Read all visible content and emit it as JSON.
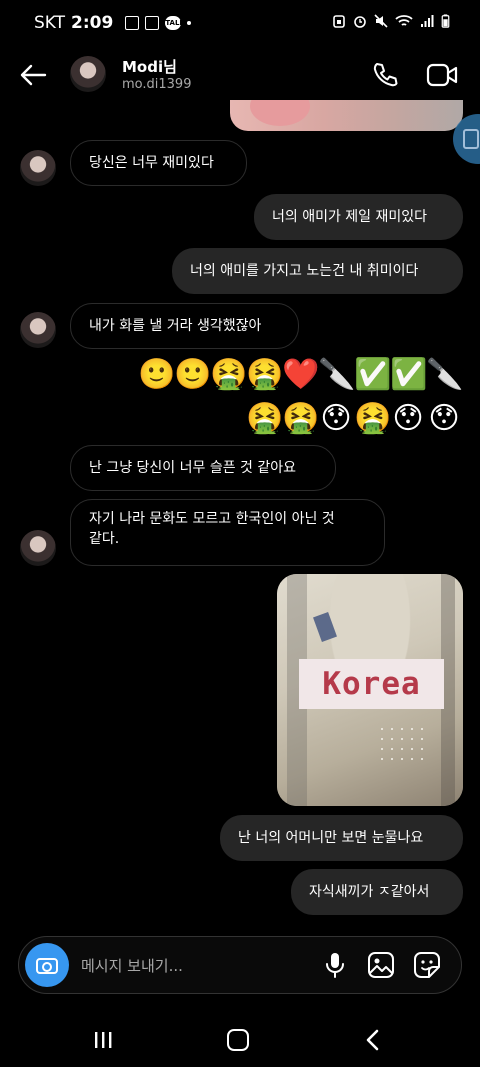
{
  "status_bar": {
    "carrier": "SKT",
    "time": "2:09",
    "left_icons": [
      "sim-card-icon",
      "gallery-icon",
      "kakaotalk-icon",
      "dot"
    ],
    "kakao_label": "TALK",
    "right_icons": [
      "alarm-icon",
      "mute-icon",
      "wifi-icon",
      "signal-icon",
      "battery-icon"
    ]
  },
  "header": {
    "name": "Modi님",
    "username": "mo.di1399",
    "icons": [
      "back-arrow-icon",
      "phone-icon",
      "video-camera-icon"
    ]
  },
  "messages": [
    {
      "side": "in",
      "text": "당신은 너무 재미있다",
      "avatar": true
    },
    {
      "side": "out",
      "text": "너의 애미가 제일 재미있다"
    },
    {
      "side": "out",
      "text": "너의 애미를 가지고 노는건 내 취미이다"
    },
    {
      "side": "in",
      "text": "내가 화를 낼 거라 생각했잖아",
      "avatar": true
    },
    {
      "side": "out",
      "emoji": [
        "🙂",
        "🙂",
        "🤮",
        "🤮",
        "❤️",
        "🔪",
        "✅",
        "✅",
        "🔪"
      ]
    },
    {
      "side": "out",
      "emoji": [
        "🤮",
        "🤮",
        "😯",
        "🤮",
        "😯",
        "😯"
      ]
    },
    {
      "side": "in",
      "text": "난 그냥 당신이 너무 슬픈 것 같아요"
    },
    {
      "side": "in",
      "text": "자기 나라 문화도 모르고 한국인이 아닌 것\n같다.",
      "avatar": true
    },
    {
      "side": "out",
      "image": {
        "overlay_text": "Korea"
      }
    },
    {
      "side": "out",
      "text": "난 너의 어머니만 보면 눈물나요"
    },
    {
      "side": "out",
      "text": "자식새끼가 ㅈ같아서"
    }
  ],
  "composer": {
    "placeholder": "메시지 보내기...",
    "icons": [
      "camera-icon",
      "microphone-icon",
      "gallery-icon",
      "sticker-icon"
    ],
    "accent": "#3797f0"
  },
  "navbar": {
    "icons": [
      "recents-icon",
      "home-icon",
      "back-icon"
    ]
  },
  "colors": {
    "background": "#000000",
    "outgoing_bubble": "#262626",
    "incoming_border": "#2b2b2b",
    "secondary_text": "#a8a8a8"
  }
}
